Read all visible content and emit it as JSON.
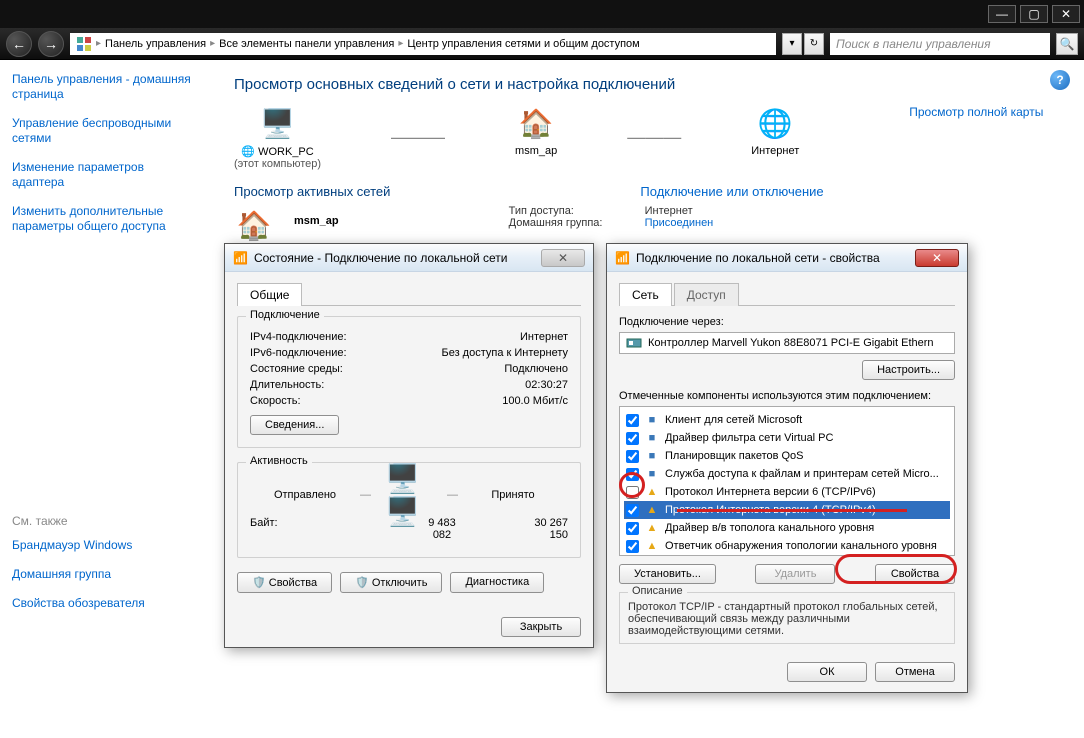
{
  "titlebar": {
    "min": "—",
    "max": "▢",
    "close": "✕"
  },
  "nav": {
    "back": "←",
    "forward": "→",
    "crumbs": [
      "Панель управления",
      "Все элементы панели управления",
      "Центр управления сетями и общим доступом"
    ],
    "search_placeholder": "Поиск в панели управления"
  },
  "sidebar": {
    "links": [
      "Панель управления - домашняя страница",
      "Управление беспроводными сетями",
      "Изменение параметров адаптера",
      "Изменить дополнительные параметры общего доступа"
    ],
    "see_also_label": "См. также",
    "see_also": [
      "Брандмауэр Windows",
      "Домашняя группа",
      "Свойства обозревателя"
    ]
  },
  "content": {
    "heading": "Просмотр основных сведений о сети и настройка подключений",
    "fullmap": "Просмотр полной карты",
    "nodes": {
      "pc_name": "WORK_PC",
      "pc_sub": "(этот компьютер)",
      "ap_name": "msm_ap",
      "net_name": "Интернет"
    },
    "active_head": "Просмотр активных сетей",
    "connect_head": "Подключение или отключение",
    "network_name": "msm_ap",
    "type_label": "Тип доступа:",
    "type_value": "Интернет",
    "hg_label": "Домашняя группа:",
    "hg_value": "Присоединен"
  },
  "status_dialog": {
    "title": "Состояние - Подключение по локальной сети",
    "tab_general": "Общие",
    "group_conn": "Подключение",
    "ipv4_k": "IPv4-подключение:",
    "ipv4_v": "Интернет",
    "ipv6_k": "IPv6-подключение:",
    "ipv6_v": "Без доступа к Интернету",
    "media_k": "Состояние среды:",
    "media_v": "Подключено",
    "dur_k": "Длительность:",
    "dur_v": "02:30:27",
    "spd_k": "Скорость:",
    "spd_v": "100.0 Мбит/с",
    "details_btn": "Сведения...",
    "group_act": "Активность",
    "sent": "Отправлено",
    "recv": "Принято",
    "bytes_k": "Байт:",
    "bytes_sent": "9 483 082",
    "bytes_recv": "30 267 150",
    "props_btn": "Свойства",
    "disable_btn": "Отключить",
    "diag_btn": "Диагностика",
    "close_btn": "Закрыть"
  },
  "props_dialog": {
    "title": "Подключение по локальной сети - свойства",
    "tab_net": "Сеть",
    "tab_share": "Доступ",
    "conn_via": "Подключение через:",
    "adapter": "Контроллер Marvell Yukon 88E8071 PCI-E Gigabit Ethern",
    "configure_btn": "Настроить...",
    "components_label": "Отмеченные компоненты используются этим подключением:",
    "components": [
      {
        "checked": true,
        "icon": "client-icon",
        "label": "Клиент для сетей Microsoft"
      },
      {
        "checked": true,
        "icon": "driver-icon",
        "label": "Драйвер фильтра сети Virtual PC"
      },
      {
        "checked": true,
        "icon": "qos-icon",
        "label": "Планировщик пакетов QoS"
      },
      {
        "checked": true,
        "icon": "share-icon",
        "label": "Служба доступа к файлам и принтерам сетей Micro..."
      },
      {
        "checked": false,
        "icon": "proto-icon",
        "label": "Протокол Интернета версии 6 (TCP/IPv6)"
      },
      {
        "checked": true,
        "icon": "proto-icon",
        "label": "Протокол Интернета версии 4 (TCP/IPv4)",
        "selected": true
      },
      {
        "checked": true,
        "icon": "topo-icon",
        "label": "Драйвер в/в тополога канального уровня"
      },
      {
        "checked": true,
        "icon": "topo-icon",
        "label": "Ответчик обнаружения топологии канального уровня"
      }
    ],
    "install_btn": "Установить...",
    "remove_btn": "Удалить",
    "props_btn": "Свойства",
    "desc_head": "Описание",
    "desc_text": "Протокол TCP/IP - стандартный протокол глобальных сетей, обеспечивающий связь между различными взаимодействующими сетями.",
    "ok_btn": "ОК",
    "cancel_btn": "Отмена"
  }
}
